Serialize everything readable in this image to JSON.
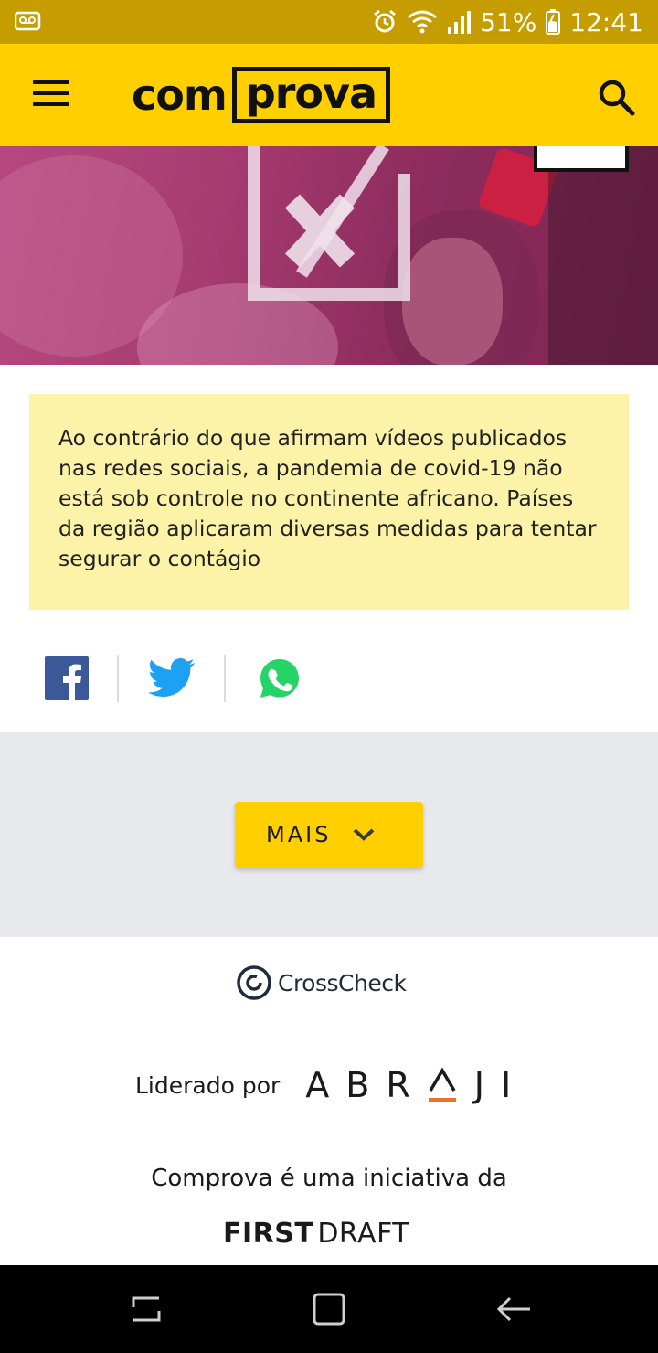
{
  "status_bar": {
    "battery": "51%",
    "time": "12:41",
    "icons": [
      "voicemail-icon",
      "alarm-icon",
      "wifi-icon",
      "signal-icon",
      "battery-icon"
    ]
  },
  "header": {
    "logo_left": "com",
    "logo_right": "prova",
    "icons": [
      "menu-icon",
      "search-icon"
    ],
    "colors": {
      "brand_yellow": "#ffcf00",
      "status_bar": "#c59d00"
    }
  },
  "summary": {
    "text": "Ao contrário do que afirmam vídeos publicados nas redes sociais, a pandemia de covid-19 não está sob controle no continente africano. Países da região aplicaram diversas medidas para tentar segurar o contágio",
    "background": "#fcf3a8"
  },
  "share": {
    "icons": [
      "facebook-icon",
      "twitter-icon",
      "whatsapp-icon"
    ]
  },
  "more": {
    "label": "MAIS"
  },
  "footer": {
    "crosscheck": "CrossCheck",
    "led_by": "Liderado por",
    "abraji_letters": [
      "A",
      "B",
      "R",
      "J",
      "I"
    ],
    "initiative": "Comprova é uma iniciativa da",
    "firstdraft_first": "FIRST",
    "firstdraft_draft": "DRAFT"
  },
  "nav_bar": {
    "icons": [
      "recent-apps-icon",
      "home-icon",
      "back-icon"
    ]
  }
}
